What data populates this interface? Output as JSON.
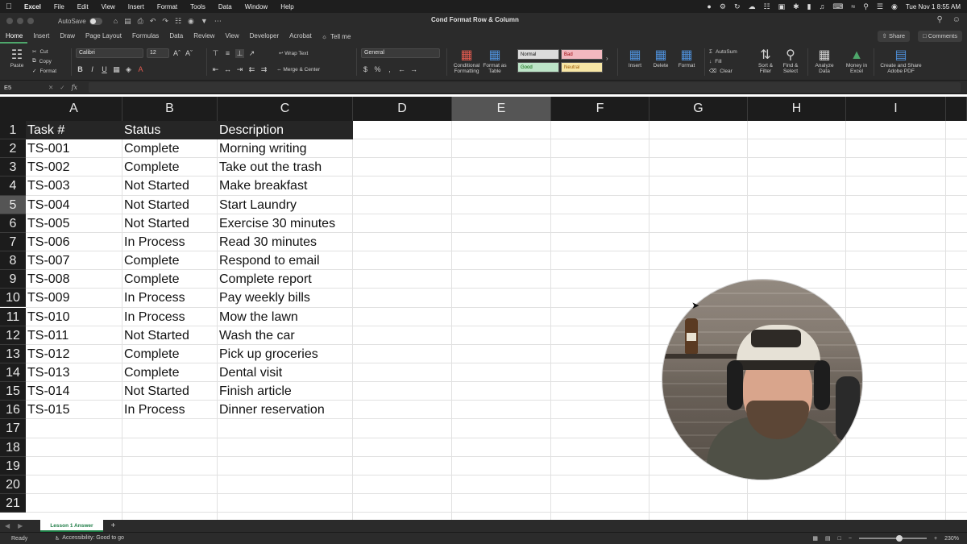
{
  "menubar": {
    "apple": "",
    "items": [
      "Excel",
      "File",
      "Edit",
      "View",
      "Insert",
      "Format",
      "Tools",
      "Data",
      "Window",
      "Help"
    ],
    "datetime": "Tue Nov 1  8:55 AM"
  },
  "titlebar": {
    "autosave_label": "AutoSave",
    "document_title": "Cond Format Row & Column"
  },
  "ribbon_tabs": {
    "tabs": [
      "Home",
      "Insert",
      "Draw",
      "Page Layout",
      "Formulas",
      "Data",
      "Review",
      "View",
      "Developer",
      "Acrobat"
    ],
    "active": "Home",
    "tell_me": "Tell me",
    "share": "Share",
    "comments": "Comments"
  },
  "ribbon": {
    "paste": "Paste",
    "cut": "Cut",
    "copy": "Copy",
    "format_painter": "Format",
    "font_name": "Calibri",
    "font_size": "12",
    "wrap_text": "Wrap Text",
    "merge_center": "Merge & Center",
    "number_format": "General",
    "conditional_formatting": "Conditional Formatting",
    "format_as_table": "Format as Table",
    "style_normal": "Normal",
    "style_bad": "Bad",
    "style_good": "Good",
    "style_neutral": "Neutral",
    "insert": "Insert",
    "delete": "Delete",
    "format": "Format",
    "autosum": "AutoSum",
    "fill": "Fill",
    "clear": "Clear",
    "sort_filter": "Sort & Filter",
    "find_select": "Find & Select",
    "analyze_data": "Analyze Data",
    "money_in_excel": "Money in Excel",
    "create_share_pdf": "Create and Share Adobe PDF"
  },
  "formula_bar": {
    "name_box": "E5",
    "fx": "fx",
    "formula": ""
  },
  "sheet": {
    "columns": [
      "A",
      "B",
      "C",
      "D",
      "E",
      "F",
      "G",
      "H",
      "I"
    ],
    "selected_column": "E",
    "selected_row": "5",
    "row_numbers": [
      "1",
      "2",
      "3",
      "4",
      "5",
      "6",
      "7",
      "8",
      "9",
      "10",
      "11",
      "12",
      "13",
      "14",
      "15",
      "16",
      "17",
      "18",
      "19",
      "20",
      "21"
    ],
    "header": [
      "Task #",
      "Status",
      "Description"
    ],
    "rows": [
      [
        "TS-001",
        "Complete",
        "Morning writing"
      ],
      [
        "TS-002",
        "Complete",
        "Take out the trash"
      ],
      [
        "TS-003",
        "Not Started",
        "Make breakfast"
      ],
      [
        "TS-004",
        "Not Started",
        "Start Laundry"
      ],
      [
        "TS-005",
        "Not Started",
        "Exercise 30 minutes"
      ],
      [
        "TS-006",
        "In Process",
        "Read 30 minutes"
      ],
      [
        "TS-007",
        "Complete",
        "Respond to email"
      ],
      [
        "TS-008",
        "Complete",
        "Complete report"
      ],
      [
        "TS-009",
        "In Process",
        "Pay weekly bills"
      ],
      [
        "TS-010",
        "In Process",
        "Mow the lawn"
      ],
      [
        "TS-011",
        "Not Started",
        "Wash the car"
      ],
      [
        "TS-012",
        "Complete",
        "Pick up groceries"
      ],
      [
        "TS-013",
        "Complete",
        "Dental visit"
      ],
      [
        "TS-014",
        "Not Started",
        "Finish article"
      ],
      [
        "TS-015",
        "In Process",
        "Dinner reservation"
      ]
    ]
  },
  "sheet_tabs": {
    "active_sheet": "Lesson 1 Answer",
    "add_label": "+"
  },
  "statusbar": {
    "ready": "Ready",
    "accessibility": "Accessibility: Good to go",
    "zoom": "230%",
    "zoom_level": 0.6
  },
  "colors": {
    "header_band": "#262626",
    "excel_green": "#1b7a43",
    "style_bad": "#f2b8bf",
    "style_good": "#bde4c8",
    "style_neutral": "#f7e6a6"
  }
}
